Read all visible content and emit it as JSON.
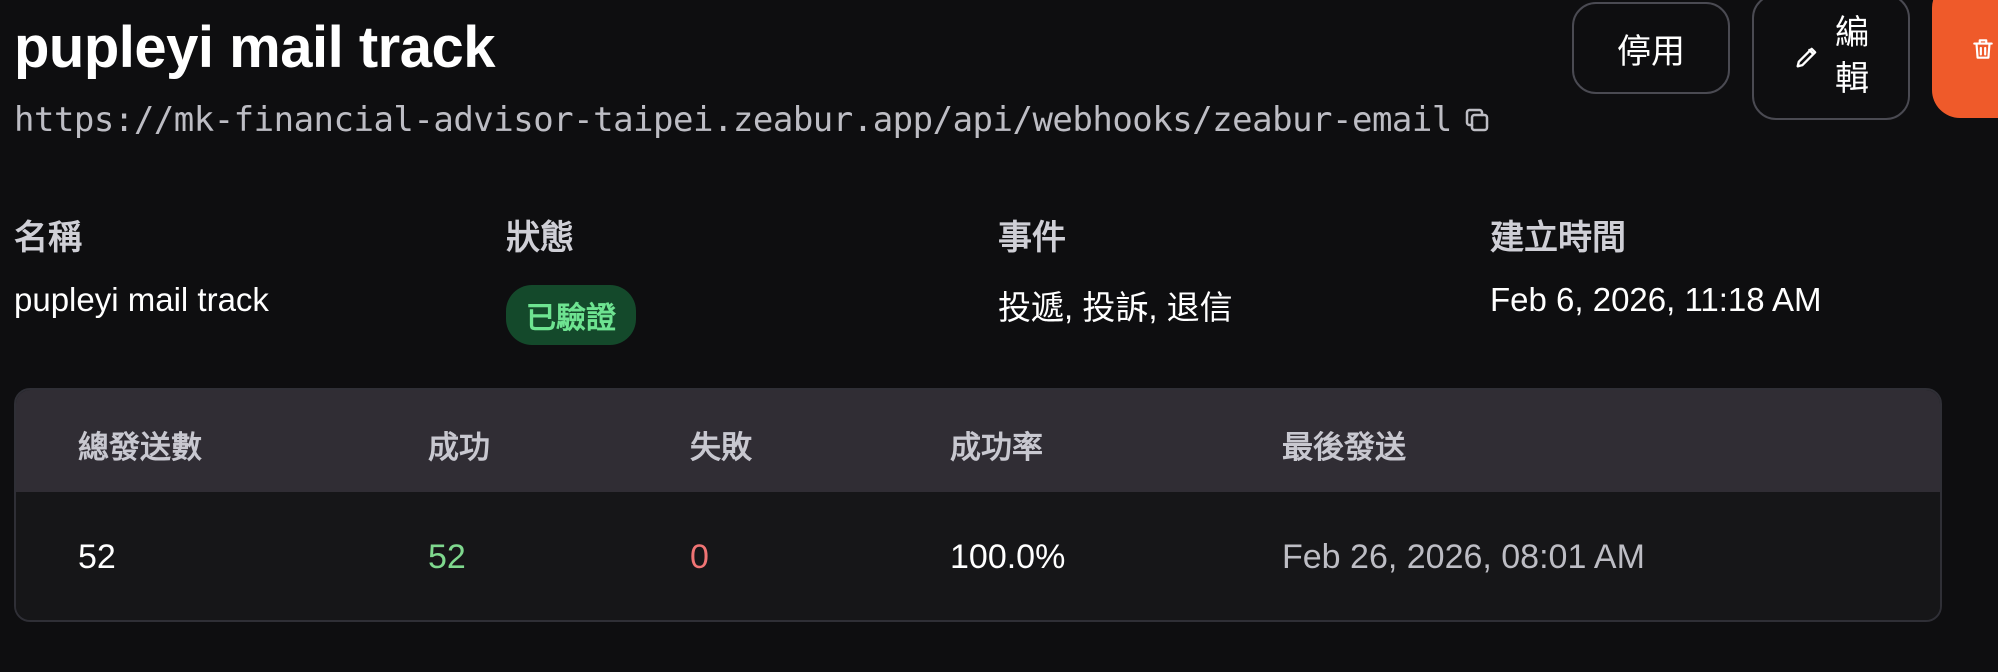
{
  "header": {
    "title": "pupleyi mail track",
    "url": "https://mk-financial-advisor-taipei.zeabur.app/api/webhooks/zeabur-email"
  },
  "actions": {
    "disable_label": "停用",
    "edit_label_line1": "編",
    "edit_label_line2": "輯"
  },
  "meta": {
    "name": {
      "label": "名稱",
      "value": "pupleyi mail track"
    },
    "status": {
      "label": "狀態",
      "value": "已驗證"
    },
    "events": {
      "label": "事件",
      "value": "投遞, 投訴, 退信"
    },
    "created": {
      "label": "建立時間",
      "value": "Feb 6, 2026, 11:18 AM"
    }
  },
  "stats": {
    "headers": [
      "總發送數",
      "成功",
      "失敗",
      "成功率",
      "最後發送"
    ],
    "values": [
      "52",
      "52",
      "0",
      "100.0%",
      "Feb 26, 2026, 08:01 AM"
    ]
  },
  "colors": {
    "background": "#0e0e10",
    "accent_delete": "#ef5a2a",
    "success_text": "#6ee391",
    "success_badge_bg": "#14492b",
    "success_value": "#7fd88e",
    "fail_value": "#f07474"
  },
  "icons": {
    "copy": "copy-icon",
    "edit": "pencil-icon",
    "delete": "trash-icon"
  }
}
